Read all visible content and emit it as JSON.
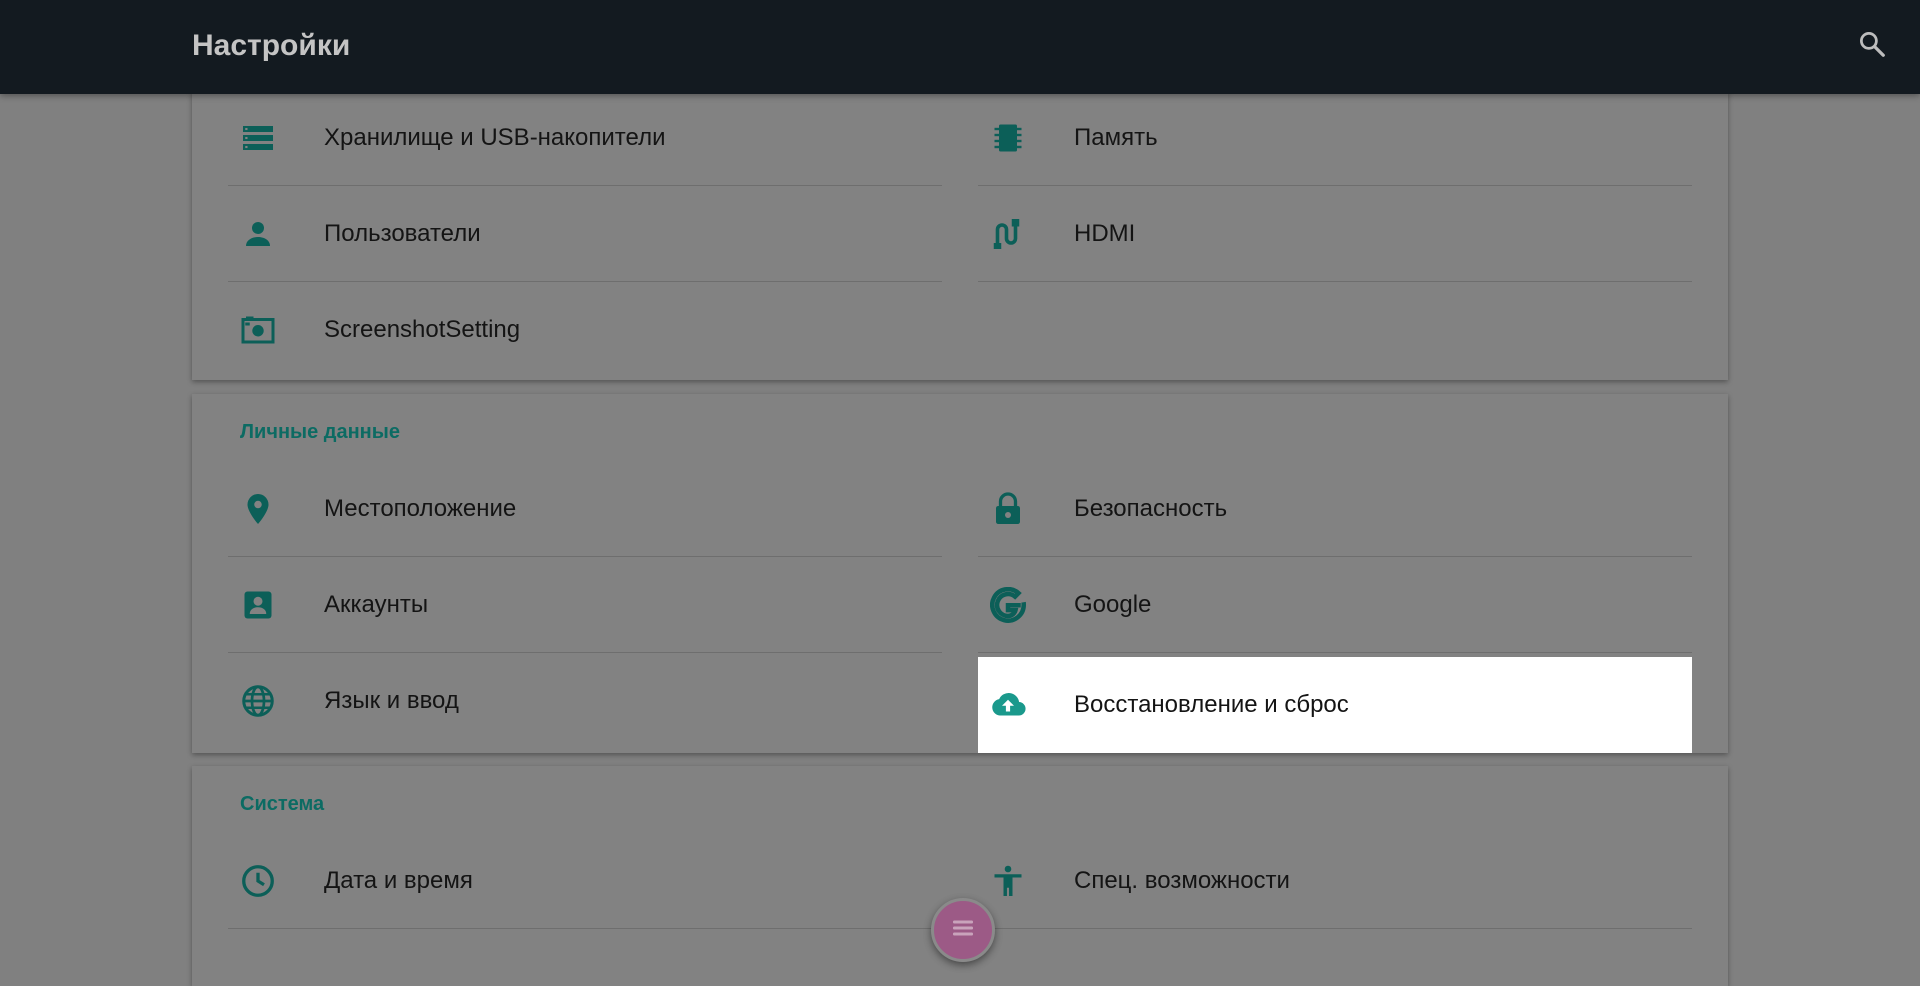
{
  "app": {
    "title": "Настройки"
  },
  "colors": {
    "accent": "#00796b",
    "topbar": "#131a20",
    "icon": "#0c5f58"
  },
  "sections": {
    "device": {
      "items": [
        {
          "label": "Хранилище и USB-накопители",
          "icon": "storage-icon"
        },
        {
          "label": "Память",
          "icon": "memory-icon"
        },
        {
          "label": "Пользователи",
          "icon": "person-icon"
        },
        {
          "label": "HDMI",
          "icon": "hdmi-cable-icon"
        },
        {
          "label": "ScreenshotSetting",
          "icon": "camera-screenshot-icon"
        }
      ]
    },
    "personal": {
      "header": "Личные данные",
      "items": [
        {
          "label": "Местоположение",
          "icon": "location-pin-icon"
        },
        {
          "label": "Безопасность",
          "icon": "lock-icon"
        },
        {
          "label": "Аккаунты",
          "icon": "account-box-icon"
        },
        {
          "label": "Google",
          "icon": "google-icon"
        },
        {
          "label": "Язык и ввод",
          "icon": "globe-icon"
        },
        {
          "label": "Восстановление и сброс",
          "icon": "cloud-upload-icon",
          "selected": true
        }
      ]
    },
    "system": {
      "header": "Система",
      "items": [
        {
          "label": "Дата и время",
          "icon": "clock-icon"
        },
        {
          "label": "Спец. возможности",
          "icon": "accessibility-icon"
        }
      ]
    }
  },
  "fab": {
    "icon": "menu-icon"
  }
}
